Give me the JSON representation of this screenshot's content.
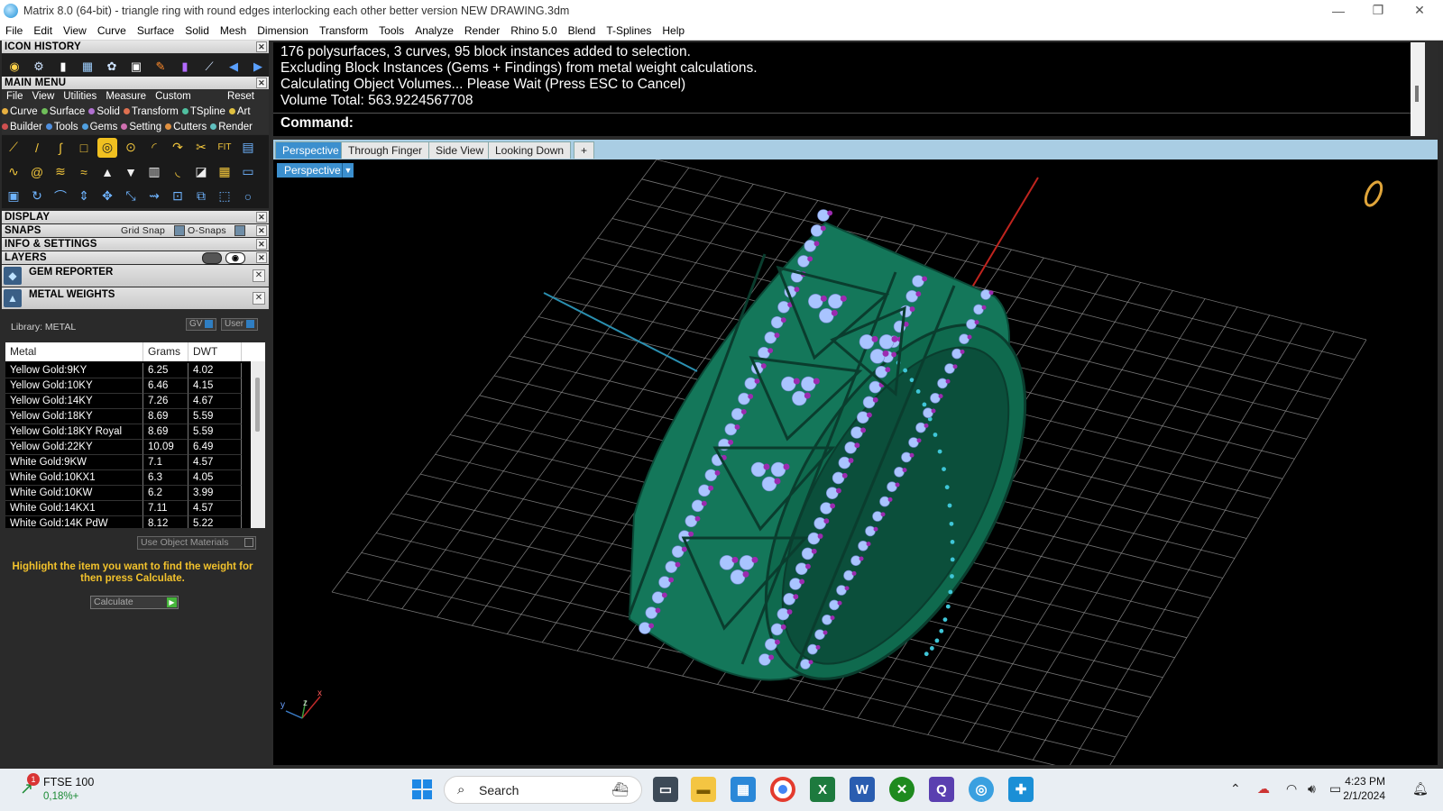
{
  "window": {
    "title": "Matrix 8.0 (64-bit) - triangle ring with round edges interlocking each other better version NEW DRAWING.3dm",
    "controls": [
      "—",
      "❐",
      "✕"
    ]
  },
  "menubar": [
    "File",
    "Edit",
    "View",
    "Curve",
    "Surface",
    "Solid",
    "Mesh",
    "Dimension",
    "Transform",
    "Tools",
    "Analyze",
    "Render",
    "Rhino 5.0",
    "Blend",
    "T-Splines",
    "Help"
  ],
  "left_panel": {
    "icon_history_title": "ICON HISTORY",
    "main_menu_title": "MAIN MENU",
    "main_menu_items": [
      "File",
      "View",
      "Utilities",
      "Measure",
      "Custom"
    ],
    "main_menu_reset": "Reset",
    "categories_row1": [
      {
        "label": "Curve",
        "color": "#e8b040"
      },
      {
        "label": "Surface",
        "color": "#6fbf5a"
      },
      {
        "label": "Solid",
        "color": "#b070d0"
      },
      {
        "label": "Transform",
        "color": "#e07050"
      },
      {
        "label": "TSpline",
        "color": "#50c0a0"
      },
      {
        "label": "Art",
        "color": "#e0c040"
      }
    ],
    "categories_row2": [
      {
        "label": "Builder",
        "color": "#d05050"
      },
      {
        "label": "Tools",
        "color": "#5090e0"
      },
      {
        "label": "Gems",
        "color": "#50a0e0"
      },
      {
        "label": "Setting",
        "color": "#d070b0"
      },
      {
        "label": "Cutters",
        "color": "#e09040"
      },
      {
        "label": "Render",
        "color": "#60c0c0"
      }
    ],
    "display_title": "DISPLAY",
    "snaps_title": "SNAPS",
    "grid_snap": "Grid Snap",
    "o_snaps": "O-Snaps",
    "info_title": "INFO & SETTINGS",
    "layers_title": "LAYERS",
    "gem_reporter_title": "GEM REPORTER",
    "metal_weights_title": "METAL WEIGHTS",
    "library_label": "Library: METAL",
    "gv_label": "GV",
    "user_label": "User",
    "table": {
      "headers": [
        "Metal",
        "Grams",
        "DWT"
      ],
      "rows": [
        [
          "Yellow Gold:9KY",
          "6.25",
          "4.02"
        ],
        [
          "Yellow Gold:10KY",
          "6.46",
          "4.15"
        ],
        [
          "Yellow Gold:14KY",
          "7.26",
          "4.67"
        ],
        [
          "Yellow Gold:18KY",
          "8.69",
          "5.59"
        ],
        [
          "Yellow Gold:18KY Royal",
          "8.69",
          "5.59"
        ],
        [
          "Yellow Gold:22KY",
          "10.09",
          "6.49"
        ],
        [
          "White Gold:9KW",
          "7.1",
          "4.57"
        ],
        [
          "White Gold:10KX1",
          "6.3",
          "4.05"
        ],
        [
          "White Gold:10KW",
          "6.2",
          "3.99"
        ],
        [
          "White Gold:14KX1",
          "7.11",
          "4.57"
        ],
        [
          "White Gold:14K PdW",
          "8.12",
          "5.22"
        ]
      ]
    },
    "use_object_materials": "Use Object Materials",
    "hint": "Highlight the item you want to find the weight for then press Calculate.",
    "calculate": "Calculate"
  },
  "command": {
    "lines": [
      "176 polysurfaces, 3 curves, 95 block instances added to selection.",
      "Excluding Block Instances (Gems + Findings) from metal weight calculations.",
      "Calculating Object Volumes... Please Wait (Press ESC to Cancel)",
      "Volume Total: 563.9224567708"
    ],
    "prompt": "Command:"
  },
  "tabs": [
    "Perspective",
    "Through Finger",
    "Side View",
    "Looking Down",
    "+"
  ],
  "viewport": {
    "label": "Perspective",
    "axis_labels": [
      "y",
      "z",
      "x"
    ],
    "colors": {
      "metal": "#14775a",
      "gem_light": "#a9c4ff",
      "gem_dark": "#9b2bb0",
      "grid": "#8f8f8f"
    }
  },
  "taskbar": {
    "ftse_name": "FTSE 100",
    "ftse_change": "0,18%+",
    "ftse_badge": "1",
    "search": "Search",
    "time": "4:23 PM",
    "date": "2/1/2024",
    "apps": [
      "start-icon",
      "file-explorer-icon",
      "folder-icon",
      "store-icon",
      "chrome-icon",
      "excel-icon",
      "word-icon",
      "xbox-icon",
      "app-icon",
      "matrix-icon",
      "rhino-icon"
    ]
  }
}
